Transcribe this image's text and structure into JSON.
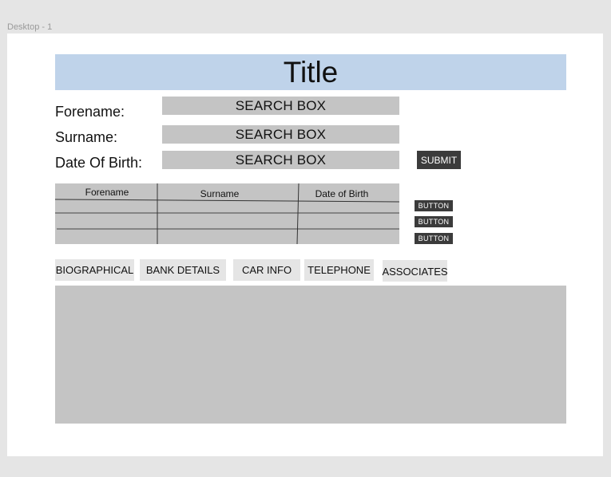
{
  "frame_label": "Desktop - 1",
  "title": "Title",
  "form": {
    "forename_label": "Forename:",
    "surname_label": "Surname:",
    "dob_label": "Date Of Birth:",
    "forename_box": "SEARCH BOX",
    "surname_box": "SEARCH BOX",
    "dob_box": "SEARCH BOX",
    "submit_label": "SUBMIT"
  },
  "table": {
    "columns": [
      "Forename",
      "Surname",
      "Date of Birth"
    ],
    "row_buttons": [
      "BUTTON",
      "BUTTON",
      "BUTTON"
    ]
  },
  "tabs": [
    "BIOGRAPHICAL",
    "BANK DETAILS",
    "CAR INFO",
    "TELEPHONE",
    "ASSOCIATES"
  ],
  "colors": {
    "title_bar": "#bfd3ea",
    "placeholder_gray": "#c4c4c4",
    "dark_button": "#3b3b3b",
    "tab_bg": "#e5e5e5"
  }
}
